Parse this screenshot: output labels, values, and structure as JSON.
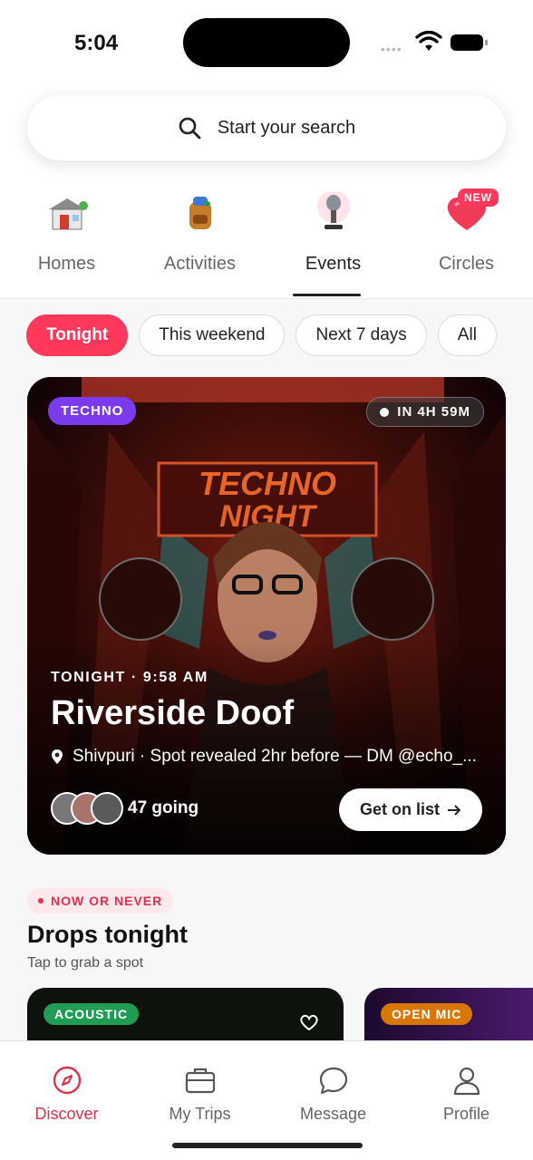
{
  "status_bar": {
    "time": "5:04"
  },
  "search": {
    "placeholder": "Start your search"
  },
  "categories": [
    {
      "label": "Homes",
      "icon": "house-icon"
    },
    {
      "label": "Activities",
      "icon": "backpack-icon"
    },
    {
      "label": "Events",
      "icon": "microphone-icon",
      "active": true
    },
    {
      "label": "Circles",
      "icon": "heart-icon",
      "badge": "NEW"
    }
  ],
  "filters": [
    "Tonight",
    "This weekend",
    "Next 7 days",
    "All"
  ],
  "featured": {
    "genre": "TECHNO",
    "countdown": "IN 4H 59M",
    "when": "TONIGHT · 9:58 AM",
    "title": "Riverside Doof",
    "location": "Shivpuri · Spot revealed 2hr before — DM @echo_...",
    "going": "47 going",
    "cta": "Get on list"
  },
  "drops": {
    "badge": "NOW OR NEVER",
    "title": "Drops tonight",
    "subtitle": "Tap to grab a spot",
    "cards": [
      {
        "tag": "ACOUSTIC"
      },
      {
        "tag": "OPEN MIC"
      }
    ]
  },
  "bottom_nav": [
    {
      "label": "Discover",
      "icon": "compass-icon",
      "active": true
    },
    {
      "label": "My Trips",
      "icon": "briefcase-icon"
    },
    {
      "label": "Message",
      "icon": "chat-icon"
    },
    {
      "label": "Profile",
      "icon": "user-icon"
    }
  ],
  "colors": {
    "accent": "#ff385c",
    "genre": "#7c3aed",
    "acoustic": "#1f9d55",
    "openmic": "#d97706"
  }
}
